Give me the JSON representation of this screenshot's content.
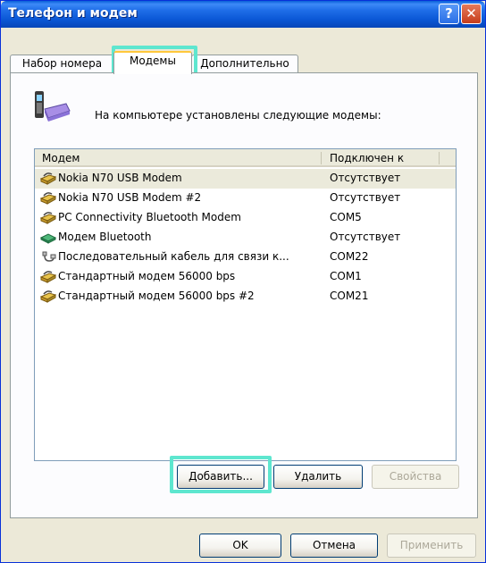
{
  "window": {
    "title": "Телефон и модем"
  },
  "titlebar": {
    "help_glyph": "?",
    "close_glyph": "✕"
  },
  "tabs": [
    {
      "label": "Набор номера"
    },
    {
      "label": "Модемы"
    },
    {
      "label": "Дополнительно"
    }
  ],
  "intro": {
    "text": "На компьютере установлены следующие модемы:"
  },
  "list": {
    "columns": [
      "Модем",
      "Подключен к"
    ],
    "rows": [
      {
        "name": "Nokia N70 USB Modem",
        "conn": "Отсутствует",
        "icon": "modem-icon"
      },
      {
        "name": "Nokia N70 USB Modem #2",
        "conn": "Отсутствует",
        "icon": "modem-icon"
      },
      {
        "name": "PC Connectivity Bluetooth Modem",
        "conn": "COM5",
        "icon": "modem-icon"
      },
      {
        "name": "Модем Bluetooth",
        "conn": "Отсутствует",
        "icon": "bluetooth-modem-icon"
      },
      {
        "name": "Последовательный кабель для связи к...",
        "conn": "COM22",
        "icon": "cable-icon"
      },
      {
        "name": "Стандартный модем 56000 bps",
        "conn": "COM1",
        "icon": "modem-icon"
      },
      {
        "name": "Стандартный модем 56000 bps #2",
        "conn": "COM21",
        "icon": "modem-icon"
      }
    ]
  },
  "buttons": {
    "add": "Добавить...",
    "remove": "Удалить",
    "properties": "Свойства",
    "ok": "OK",
    "cancel": "Отмена",
    "apply": "Применить"
  }
}
